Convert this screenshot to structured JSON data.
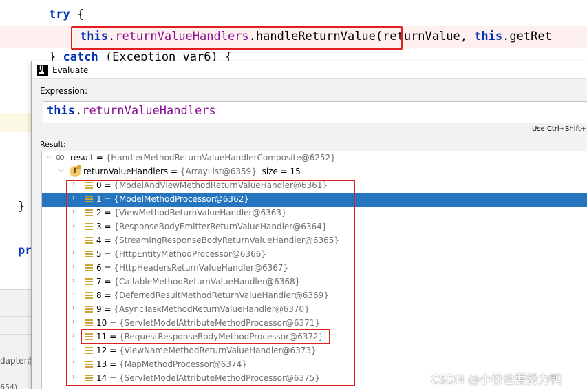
{
  "editor": {
    "try_keyword": "try",
    "open_brace": "{",
    "line2": {
      "this1": "this",
      "field": "returnValueHandlers",
      "call": ".handleReturnValue(returnValue, ",
      "this2": "this",
      "tail": ".getRet"
    },
    "catch_line": {
      "brace": "}",
      "keyword": "catch",
      "rest": "(Exception var6) {"
    },
    "close_brace": "}",
    "pr_fragment": "pr",
    "bottom_panel": {
      "text1": "dapter@",
      "text2": "654)"
    }
  },
  "dialog": {
    "title": "Evaluate",
    "expression_label": "Expression:",
    "expression": {
      "this": "this",
      "dot": ".",
      "field": "returnValueHandlers"
    },
    "hint": "Use Ctrl+Shift+",
    "result_label": "Result:",
    "result": {
      "name": "result",
      "value": "{HandlerMethodReturnValueHandlerComposite@6252}"
    },
    "handlers": {
      "name": "returnValueHandlers",
      "value": "{ArrayList@6359}",
      "size": "size = 15"
    },
    "items": [
      {
        "index": "0",
        "value": "{ModelAndViewMethodReturnValueHandler@6361}"
      },
      {
        "index": "1",
        "value": "{ModelMethodProcessor@6362}"
      },
      {
        "index": "2",
        "value": "{ViewMethodReturnValueHandler@6363}"
      },
      {
        "index": "3",
        "value": "{ResponseBodyEmitterReturnValueHandler@6364}"
      },
      {
        "index": "4",
        "value": "{StreamingResponseBodyReturnValueHandler@6365}"
      },
      {
        "index": "5",
        "value": "{HttpEntityMethodProcessor@6366}"
      },
      {
        "index": "6",
        "value": "{HttpHeadersReturnValueHandler@6367}"
      },
      {
        "index": "7",
        "value": "{CallableMethodReturnValueHandler@6368}"
      },
      {
        "index": "8",
        "value": "{DeferredResultMethodReturnValueHandler@6369}"
      },
      {
        "index": "9",
        "value": "{AsyncTaskMethodReturnValueHandler@6370}"
      },
      {
        "index": "10",
        "value": "{ServletModelAttributeMethodProcessor@6371}"
      },
      {
        "index": "11",
        "value": "{RequestResponseBodyMethodProcessor@6372}"
      },
      {
        "index": "12",
        "value": "{ViewNameMethodReturnValueHandler@6373}"
      },
      {
        "index": "13",
        "value": "{MapMethodProcessor@6374}"
      },
      {
        "index": "14",
        "value": "{ServletModelAttributeMethodProcessor@6375}"
      }
    ],
    "selected_index": 1
  },
  "watermark": "CSDN @小徐也要努力鸭",
  "colors": {
    "keyword": "#0033b3",
    "field": "#871094",
    "selection": "#2675bf",
    "annotation_red": "#e02020"
  }
}
